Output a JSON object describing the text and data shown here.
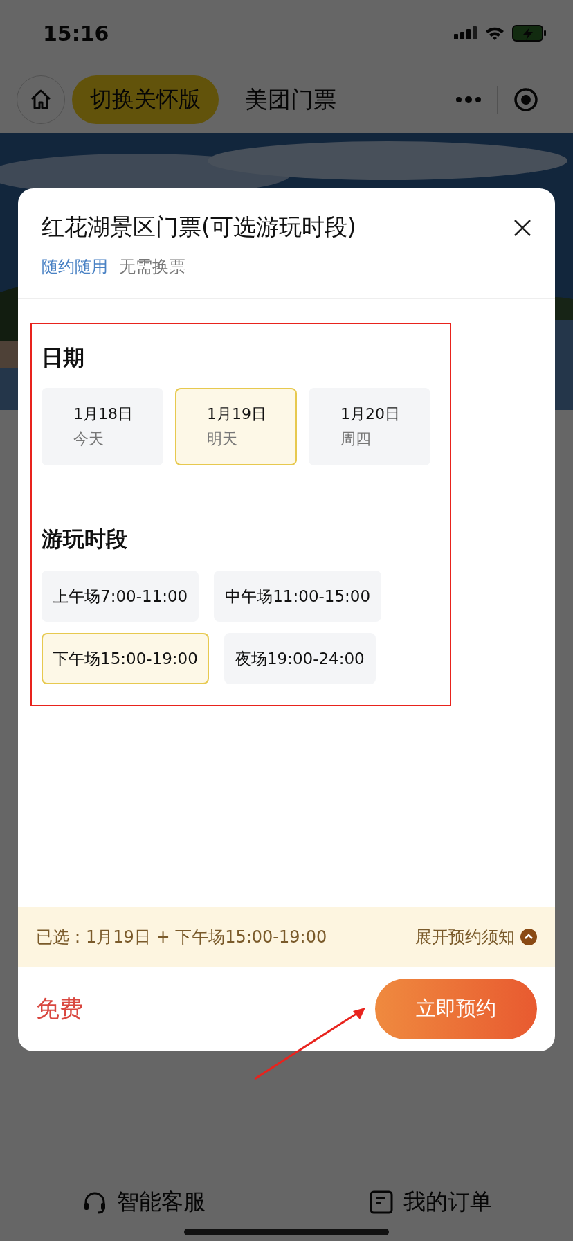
{
  "status_bar": {
    "time": "15:16"
  },
  "nav_bar": {
    "care_button": "切换关怀版",
    "title": "美团门票"
  },
  "dialog": {
    "title": "红花湖景区门票(可选游玩时段)",
    "tags": [
      {
        "text": "随约随用",
        "kind": "highlight"
      },
      {
        "text": "无需换票",
        "kind": "plain"
      }
    ],
    "date_heading": "日期",
    "dates": [
      {
        "date": "1月18日",
        "day": "今天",
        "selected": false
      },
      {
        "date": "1月19日",
        "day": "明天",
        "selected": true
      },
      {
        "date": "1月20日",
        "day": "周四",
        "selected": false
      }
    ],
    "slot_heading": "游玩时段",
    "slots": [
      {
        "label": "上午场7:00-11:00",
        "selected": false
      },
      {
        "label": "中午场11:00-15:00",
        "selected": false
      },
      {
        "label": "下午场15:00-19:00",
        "selected": true
      },
      {
        "label": "夜场19:00-24:00",
        "selected": false
      }
    ],
    "summary": "已选：1月19日 + 下午场15:00-19:00",
    "notice_toggle": "展开预约须知",
    "price": "免费",
    "book_button": "立即预约"
  },
  "bottom_bar": {
    "items": [
      {
        "label": "智能客服",
        "kind": "service"
      },
      {
        "label": "我的订单",
        "kind": "orders"
      }
    ]
  }
}
